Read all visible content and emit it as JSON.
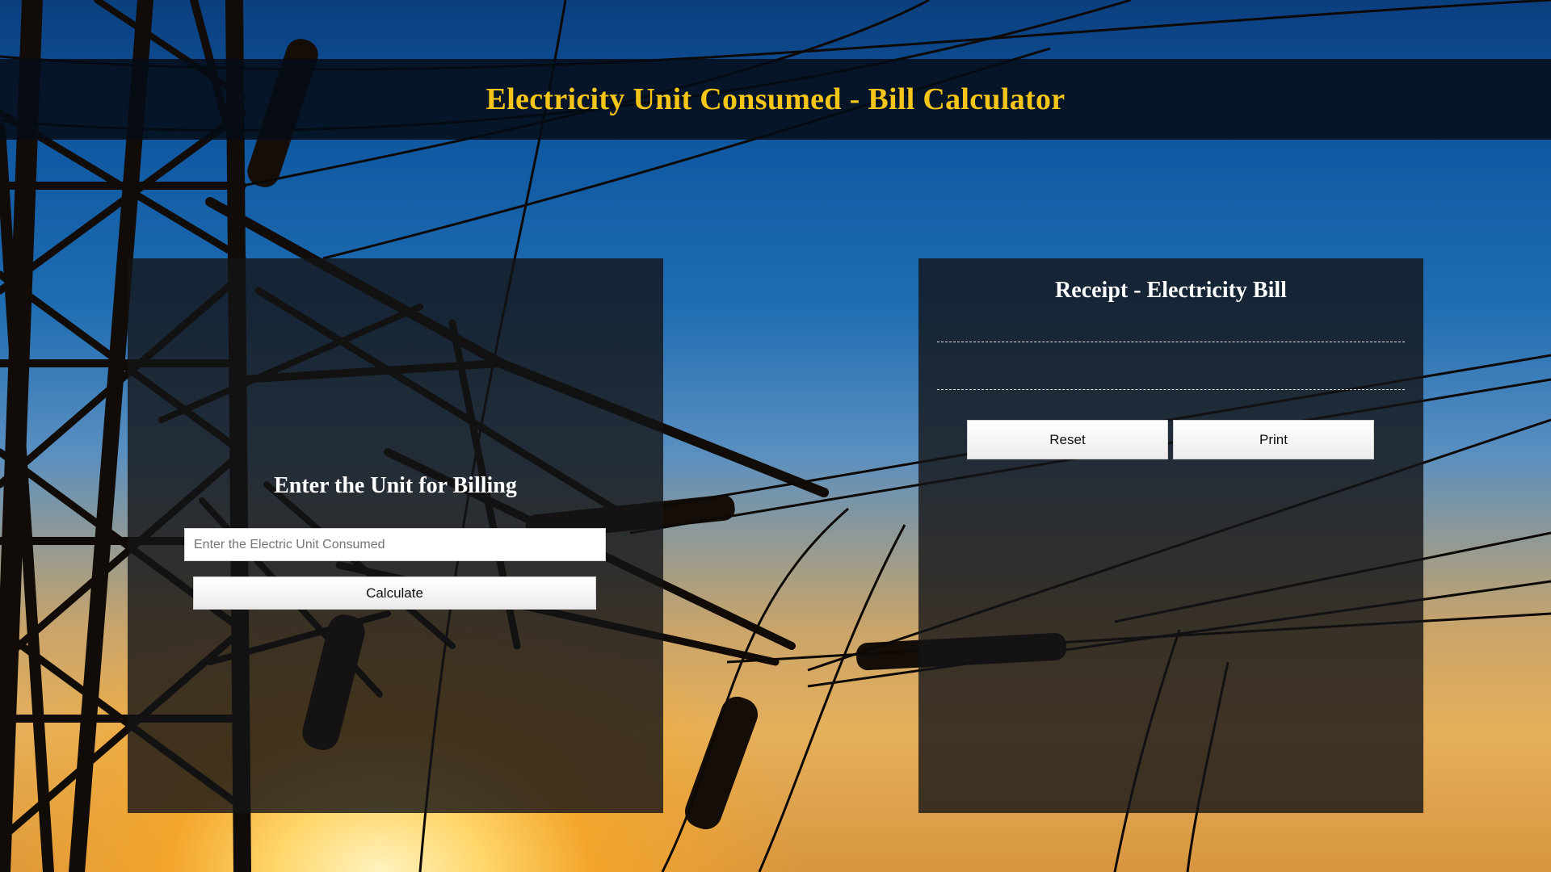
{
  "header": {
    "title": "Electricity Unit Consumed - Bill Calculator"
  },
  "input_panel": {
    "heading": "Enter the Unit for Billing",
    "unit_input": {
      "value": "",
      "placeholder": "Enter the Electric Unit Consumed"
    },
    "calculate_label": "Calculate"
  },
  "receipt_panel": {
    "heading": "Receipt - Electricity Bill",
    "content": "",
    "reset_label": "Reset",
    "print_label": "Print"
  },
  "background": {
    "scene": "electricity-transmission-tower-at-sunset"
  }
}
